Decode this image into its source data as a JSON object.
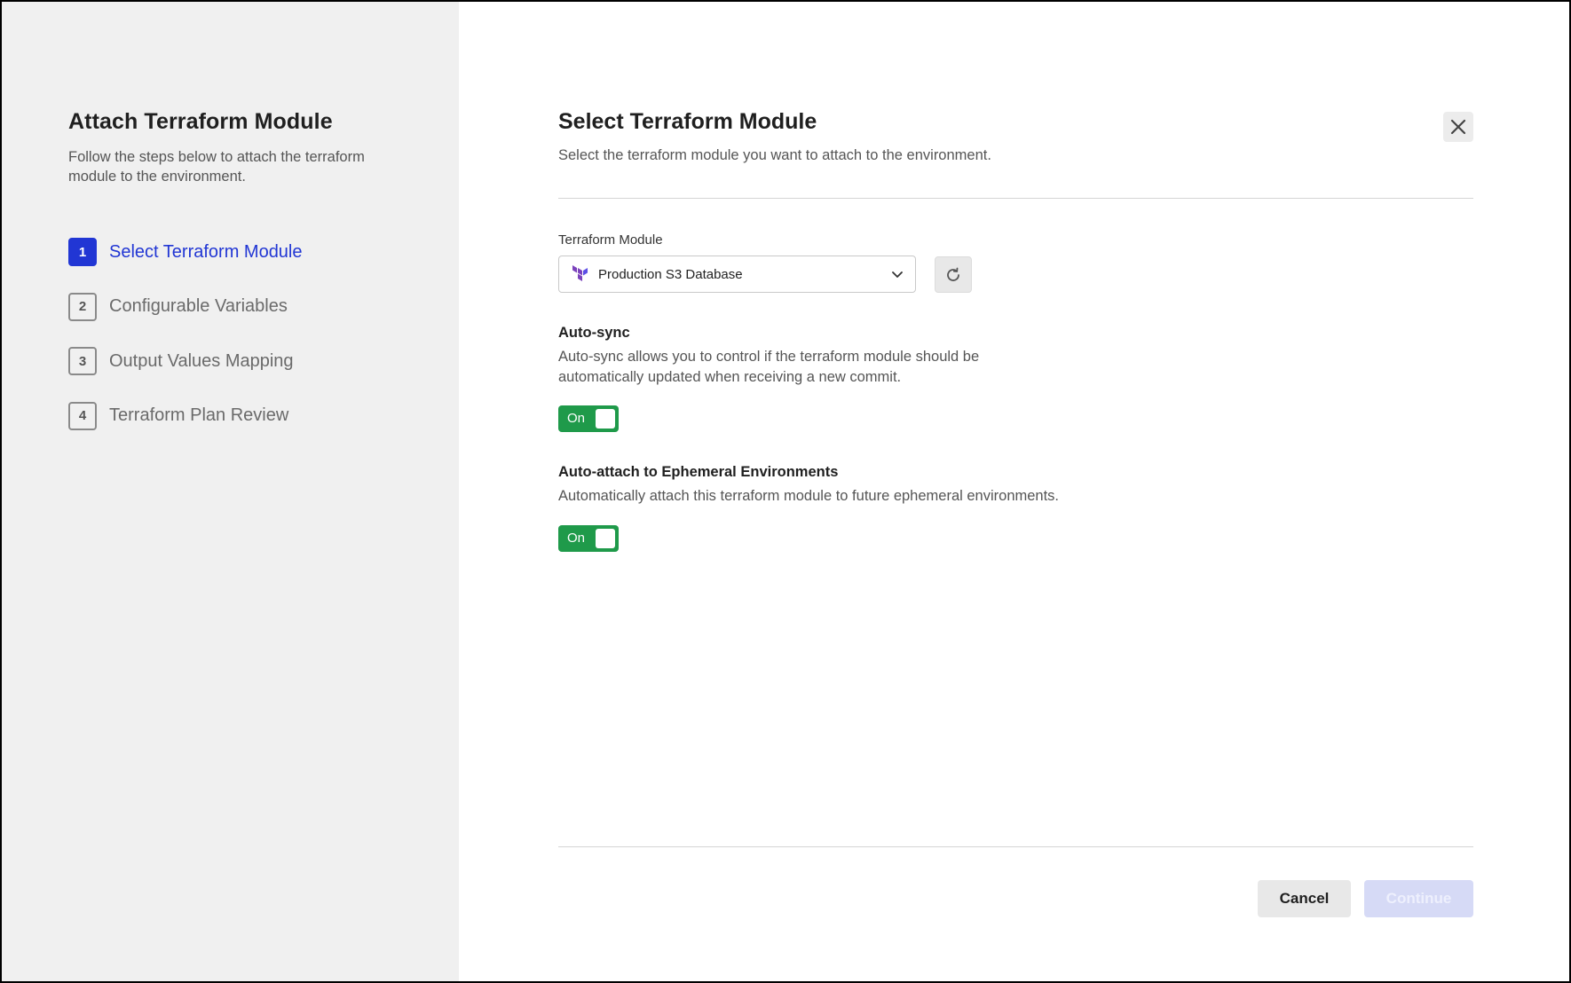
{
  "sidebar": {
    "title": "Attach Terraform Module",
    "description": "Follow the steps below to attach the terraform module to the environment.",
    "steps": [
      {
        "number": "1",
        "label": "Select Terraform Module",
        "active": true
      },
      {
        "number": "2",
        "label": "Configurable Variables",
        "active": false
      },
      {
        "number": "3",
        "label": "Output Values Mapping",
        "active": false
      },
      {
        "number": "4",
        "label": "Terraform Plan Review",
        "active": false
      }
    ]
  },
  "main": {
    "title": "Select Terraform Module",
    "subtitle": "Select the terraform module you want to attach to the environment.",
    "module_field": {
      "label": "Terraform Module",
      "selected_value": "Production S3 Database",
      "icon": "terraform-logo-icon"
    },
    "auto_sync": {
      "title": "Auto-sync",
      "description": "Auto-sync allows you to control if the terraform module should be automatically updated when receiving a new commit.",
      "toggle_label": "On",
      "enabled": true
    },
    "auto_attach": {
      "title": "Auto-attach to Ephemeral Environments",
      "description": "Automatically attach this terraform module to future ephemeral environments.",
      "toggle_label": "On",
      "enabled": true
    }
  },
  "footer": {
    "cancel_label": "Cancel",
    "continue_label": "Continue",
    "continue_disabled": true
  },
  "colors": {
    "accent": "#2136d4",
    "toggle_on": "#1f9a4a",
    "terraform_purple": "#7b42bc",
    "sidebar_bg": "#f0f0f0",
    "continue_disabled_bg": "#d6daf6"
  }
}
